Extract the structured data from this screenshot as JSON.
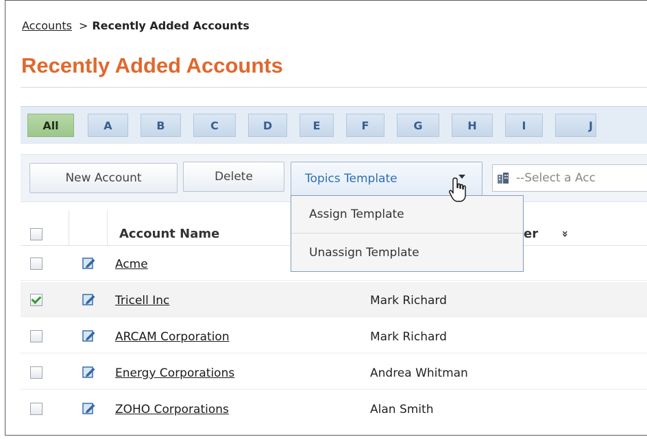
{
  "breadcrumb": {
    "root": "Accounts",
    "separator": ">",
    "current": "Recently Added Accounts"
  },
  "page_title": "Recently Added Accounts",
  "alpha_filter": [
    "All",
    "A",
    "B",
    "C",
    "D",
    "E",
    "F",
    "G",
    "H",
    "I",
    "J"
  ],
  "toolbar": {
    "new_account": "New Account",
    "delete": "Delete",
    "topics_template": "Topics Template",
    "select_placeholder": "--Select a Acc"
  },
  "dropdown": {
    "items": [
      "Assign Template",
      "Unassign Template"
    ]
  },
  "table": {
    "headers": {
      "account_name": "Account Name",
      "owner_partial": "er",
      "sort_icon": "»"
    },
    "rows": [
      {
        "name": "Acme",
        "owner": "",
        "checked": false
      },
      {
        "name": "Tricell Inc",
        "owner": "Mark Richard",
        "checked": true
      },
      {
        "name": "ARCAM Corporation",
        "owner": "Mark Richard",
        "checked": false
      },
      {
        "name": "Energy Corporations",
        "owner": "Andrea Whitman",
        "checked": false
      },
      {
        "name": "ZOHO Corporations",
        "owner": "Alan Smith",
        "checked": false
      }
    ]
  },
  "colors": {
    "title": "#e0682d",
    "topics_text": "#2c6fb1",
    "active_tab": "#9cc78a"
  }
}
